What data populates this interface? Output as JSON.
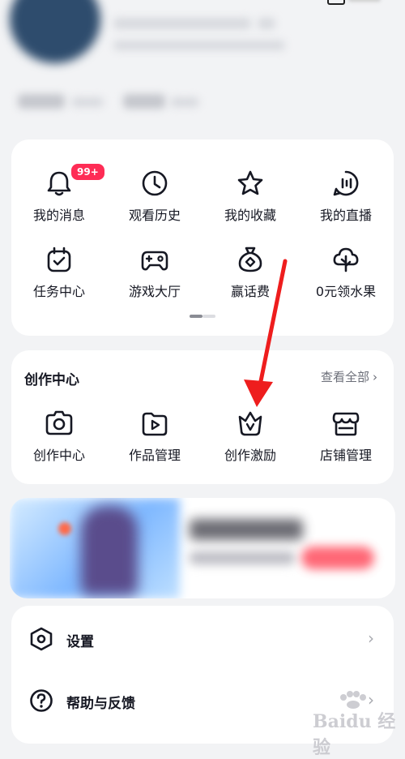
{
  "grid": {
    "items": [
      {
        "label": "我的消息",
        "icon": "bell-icon",
        "badge": "99+"
      },
      {
        "label": "观看历史",
        "icon": "clock-icon"
      },
      {
        "label": "我的收藏",
        "icon": "star-icon"
      },
      {
        "label": "我的直播",
        "icon": "live-icon"
      },
      {
        "label": "任务中心",
        "icon": "task-calendar-icon"
      },
      {
        "label": "游戏大厅",
        "icon": "gamepad-icon"
      },
      {
        "label": "赢话费",
        "icon": "money-bag-icon"
      },
      {
        "label": "0元领水果",
        "icon": "fruit-tree-icon"
      }
    ],
    "pager": {
      "pages": 2,
      "active": 1
    }
  },
  "creation": {
    "title": "创作中心",
    "view_all": "查看全部",
    "items": [
      {
        "label": "创作中心",
        "icon": "camera-icon"
      },
      {
        "label": "作品管理",
        "icon": "video-folder-icon"
      },
      {
        "label": "创作激励",
        "icon": "crown-v-icon"
      },
      {
        "label": "店铺管理",
        "icon": "store-icon"
      }
    ]
  },
  "settings": {
    "rows": [
      {
        "label": "设置",
        "icon": "settings-hexagon-icon"
      },
      {
        "label": "帮助与反馈",
        "icon": "help-icon"
      }
    ]
  },
  "annotation": {
    "type": "red-arrow",
    "target": "创作激励",
    "color": "#ee1d1d"
  },
  "watermark": {
    "text": "Baidu 经验"
  },
  "colors": {
    "accent": "#fe2c55",
    "background": "#f2f3f5",
    "text": "#161823",
    "muted": "#6b6e78"
  }
}
